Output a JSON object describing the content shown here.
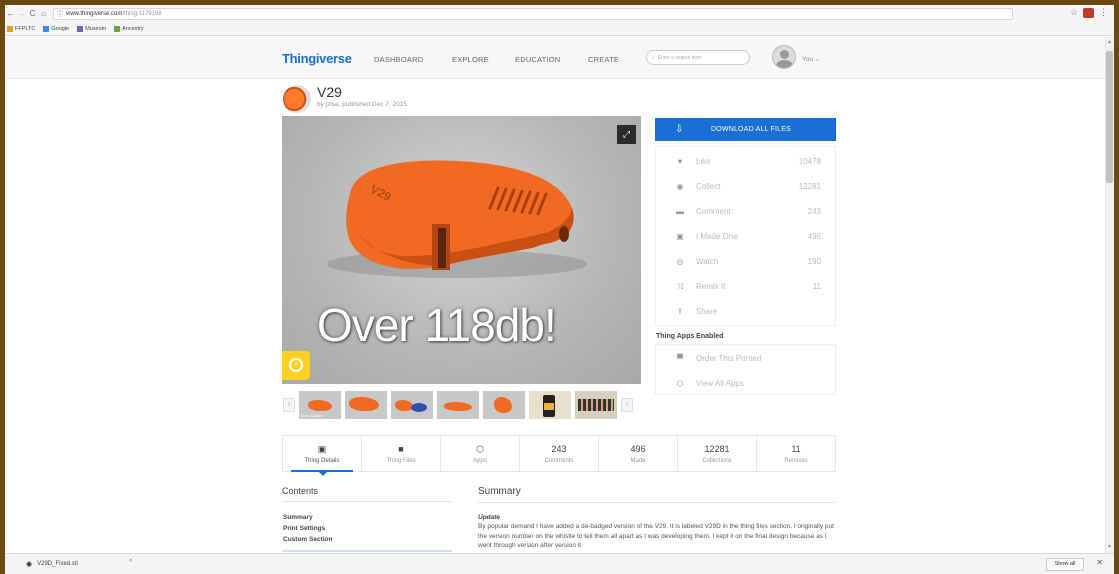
{
  "browser": {
    "url_main": "www.thingiverse.com",
    "url_rest": "/thing:1179168",
    "back": "←",
    "forward": "→",
    "reload": "C",
    "home": "⌂",
    "info": "ⓘ",
    "star": "☆",
    "menu": "⋮",
    "bookmarks": [
      {
        "label": "FFPLTC",
        "color": "#e0a030"
      },
      {
        "label": "Google",
        "color": "#4285f4"
      },
      {
        "label": "Museum",
        "color": "#7b5fb0"
      },
      {
        "label": "Ancestry",
        "color": "#6aa342"
      }
    ]
  },
  "site": {
    "logo": "Thingiverse",
    "nav": [
      "DASHBOARD",
      "EXPLORE",
      "EDUCATION",
      "CREATE"
    ],
    "search_placeholder": "Enter a search term",
    "user_label": "You ⌄"
  },
  "thing": {
    "title": "V29",
    "byline": "by jzisa, published Dec 7, 2015",
    "hero_caption": "Over 118db!",
    "embossed": "V29"
  },
  "thumbnails": {
    "prev": "‹",
    "next": "›",
    "first_label": "Over 118db!"
  },
  "panel": {
    "download_label": "DOWNLOAD ALL FILES",
    "actions": [
      {
        "label": "Like",
        "value": "10478",
        "icon": "♥"
      },
      {
        "label": "Collect",
        "value": "12281",
        "icon": "◉"
      },
      {
        "label": "Comment",
        "value": "243",
        "icon": "▬"
      },
      {
        "label": "I Made One",
        "value": "496",
        "icon": "▣"
      },
      {
        "label": "Watch",
        "value": "190",
        "icon": "◎"
      },
      {
        "label": "Remix It",
        "value": "11",
        "icon": "⤨"
      },
      {
        "label": "Share",
        "value": "",
        "icon": "⇪"
      }
    ],
    "apps_title": "Thing Apps Enabled",
    "apps": [
      {
        "label": "Order This Printed",
        "icon": "▀"
      },
      {
        "label": "View All Apps",
        "icon": "⬡"
      }
    ]
  },
  "tabs": [
    {
      "icon": "▣",
      "num": "",
      "label": "Thing Details"
    },
    {
      "icon": "■",
      "num": "",
      "label": "Thing Files"
    },
    {
      "icon": "⬡",
      "num": "",
      "label": "Apps"
    },
    {
      "icon": "",
      "num": "243",
      "label": "Comments"
    },
    {
      "icon": "",
      "num": "496",
      "label": "Made"
    },
    {
      "icon": "",
      "num": "12281",
      "label": "Collections"
    },
    {
      "icon": "",
      "num": "11",
      "label": "Remixes"
    }
  ],
  "contents": {
    "heading": "Contents",
    "items": [
      "Summary",
      "Print Settings",
      "Custom Section"
    ]
  },
  "summary": {
    "heading": "Summary",
    "update_label": "Update",
    "text": "By popular demand I have added a de-badged version of the V29. It is labeled V29D in the thing files section. I originally put the version number on the whistle to tell them all apart as I was developing them. I kept it on the final design because as I went through version after version it"
  },
  "download_bar": {
    "file": "V29D_Fixed.stl",
    "chevron": "^",
    "show_all": "Show all",
    "close": "✕"
  },
  "colors": {
    "brand": "#196fd3",
    "whistle": "#f06a22",
    "bulb": "#ffd21f"
  }
}
